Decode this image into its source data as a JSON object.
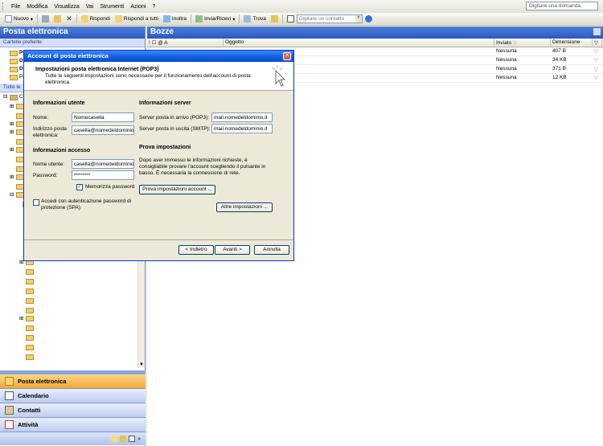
{
  "menu": {
    "items": [
      "File",
      "Modifica",
      "Visualizza",
      "Vai",
      "Strumenti",
      "Azioni",
      "?"
    ],
    "help_placeholder": "Digitare una domanda."
  },
  "toolbar": {
    "new_label": "Nuovo",
    "reply_label": "Rispondi",
    "reply_all_label": "Rispondi a tutti",
    "forward_label": "Inoltra",
    "send_receive_label": "Invia/Ricevi",
    "find_label": "Trova",
    "contact_placeholder": "Digitare un contatto"
  },
  "left": {
    "title": "Posta elettronica",
    "favorites_label": "Cartelle preferite",
    "all_label": "Tutte le",
    "fav_items": [
      "Po",
      "D",
      "D",
      "Po"
    ],
    "tree_root": "Ca"
  },
  "nav": {
    "buttons": [
      "Posta elettronica",
      "Calendario",
      "Contatti",
      "Attività"
    ]
  },
  "right": {
    "title": "Bozze",
    "columns": [
      "! ☐ @ A",
      "Oggetto",
      "Inviato",
      "Dimensione"
    ],
    "rows": [
      {
        "sent": "Nessuna",
        "size": "407 B"
      },
      {
        "sent": "Nessuna",
        "size": "34 KB"
      },
      {
        "sent": "Nessuna",
        "size": "371 B"
      },
      {
        "sent": "Nessuna",
        "size": "12 KB"
      }
    ]
  },
  "dialog": {
    "title": "Account di posta elettronica",
    "banner_title": "Impostazioni posta elettronica Internet (POP3)",
    "banner_desc": "Tutte le seguenti impostazioni sono necessarie per il funzionamento dell'account di posta elettronica.",
    "user_info": {
      "title": "Informazioni utente",
      "name_label": "Nome:",
      "name_value": "Nomecasella",
      "email_label": "Indirizzo posta elettronica:",
      "email_value": "casella@nomedeldominio.it"
    },
    "login_info": {
      "title": "Informazioni accesso",
      "user_label": "Nome utente:",
      "user_value": "casella@nomedeldominio.it",
      "password_label": "Password:",
      "password_value": "********",
      "remember_label": "Memorizza password",
      "spa_label": "Accedi con autenticazione password di protezione (SPA)"
    },
    "server_info": {
      "title": "Informazioni server",
      "incoming_label": "Server posta in arrivo (POP3):",
      "incoming_value": "mail.nomedeldominio.it",
      "outgoing_label": "Server posta in uscita (SMTP):",
      "outgoing_value": "mail.nomedeldominio.it"
    },
    "test": {
      "title": "Prova impostazioni",
      "desc": "Dopo aver immesso le informazioni richieste, è consigliabile provare l'account scegliendo il pulsante in basso. È necessaria la connessione di rete.",
      "test_button": "Prova impostazioni account ...",
      "more_button": "Altre impostazioni ..."
    },
    "buttons": {
      "back": "< Indietro",
      "next": "Avanti >",
      "cancel": "Annulla"
    }
  }
}
